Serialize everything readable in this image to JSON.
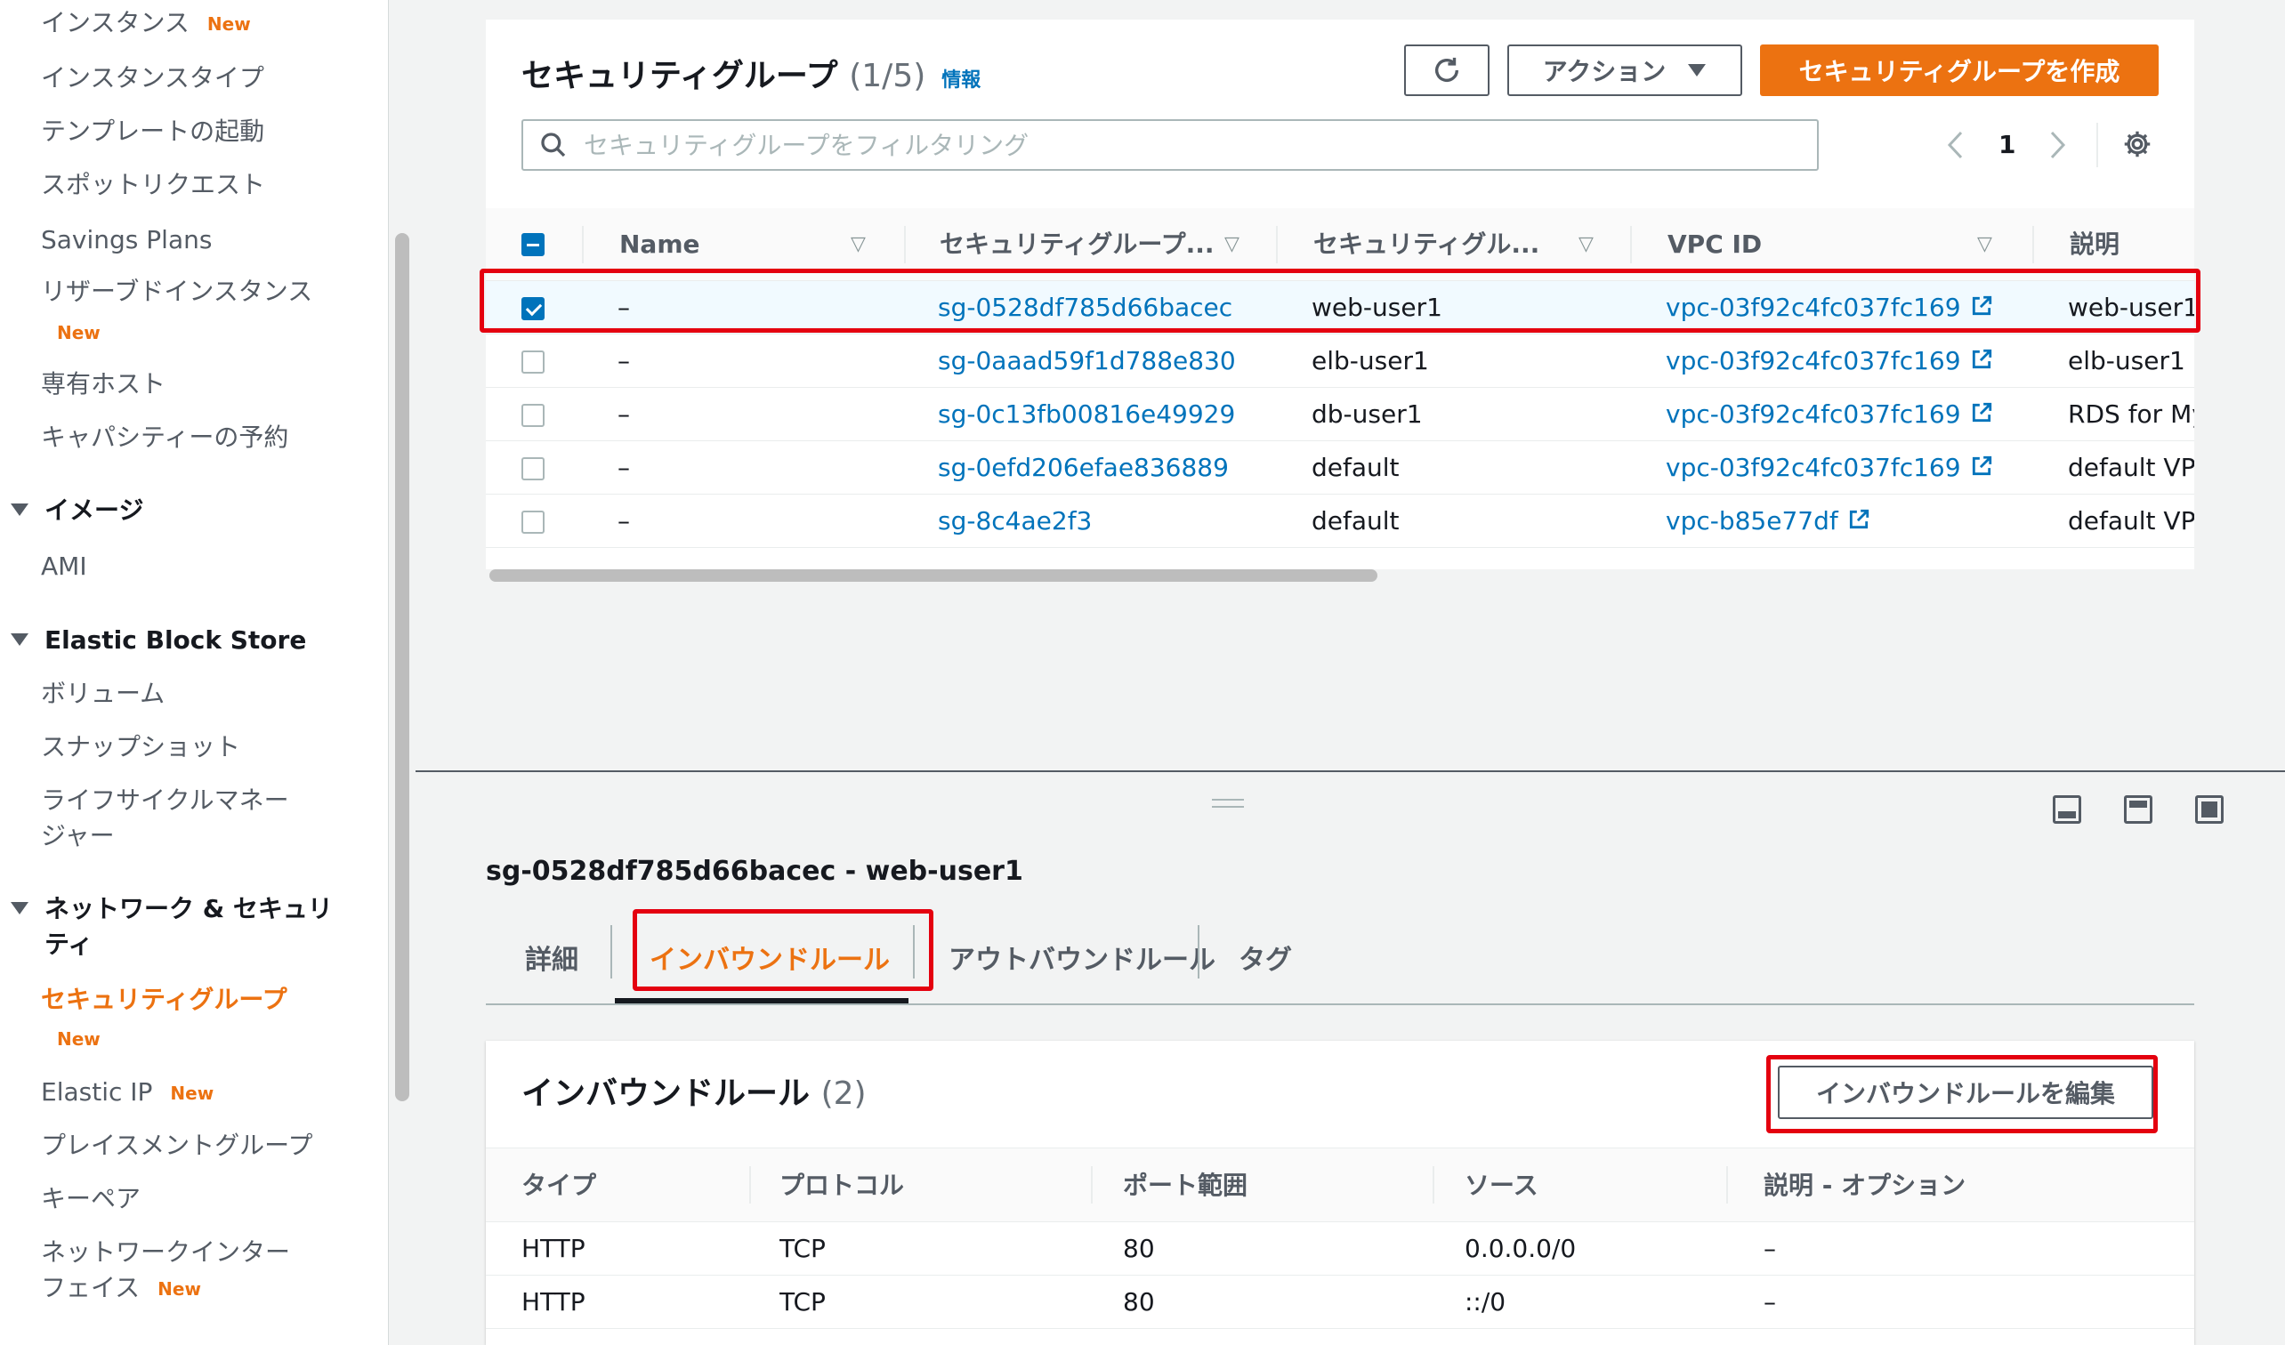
{
  "sidebar": {
    "items": [
      {
        "label": "インスタンス",
        "badge": "New"
      },
      {
        "label": "インスタンスタイプ"
      },
      {
        "label": "テンプレートの起動"
      },
      {
        "label": "スポットリクエスト"
      },
      {
        "label": "Savings Plans"
      },
      {
        "label": "リザーブドインスタンス",
        "badge": "New"
      },
      {
        "label": "専有ホスト"
      },
      {
        "label": "キャパシティーの予約"
      }
    ],
    "images_section": {
      "title": "イメージ",
      "items": [
        {
          "label": "AMI"
        }
      ]
    },
    "ebs_section": {
      "title": "Elastic Block Store",
      "items": [
        {
          "label": "ボリューム"
        },
        {
          "label": "スナップショット"
        },
        {
          "label": "ライフサイクルマネー",
          "label2": "ジャー"
        }
      ]
    },
    "network_section": {
      "title": "ネットワーク & セキュリ",
      "title2": "ティ",
      "items": [
        {
          "label": "セキュリティグループ",
          "badge": "New",
          "active": true
        },
        {
          "label": "Elastic IP",
          "badge": "New"
        },
        {
          "label": "プレイスメントグループ"
        },
        {
          "label": "キーペア"
        },
        {
          "label": "ネットワークインター",
          "label2": "フェイス",
          "badge": "New"
        }
      ]
    }
  },
  "sg_list": {
    "title": "セキュリティグループ",
    "count": "(1/5)",
    "info": "情報",
    "actions_label": "アクション",
    "create_label": "セキュリティグループを作成",
    "search_placeholder": "セキュリティグループをフィルタリング",
    "page": "1",
    "columns": [
      "Name",
      "セキュリティグループ...",
      "セキュリティグル...",
      "VPC ID",
      "説明"
    ],
    "rows": [
      {
        "name": "–",
        "sg_id": "sg-0528df785d66bacec",
        "sg_name": "web-user1",
        "vpc": "vpc-03f92c4fc037fc169",
        "desc": "web-user1",
        "selected": true
      },
      {
        "name": "–",
        "sg_id": "sg-0aaad59f1d788e830",
        "sg_name": "elb-user1",
        "vpc": "vpc-03f92c4fc037fc169",
        "desc": "elb-user1",
        "selected": false
      },
      {
        "name": "–",
        "sg_id": "sg-0c13fb00816e49929",
        "sg_name": "db-user1",
        "vpc": "vpc-03f92c4fc037fc169",
        "desc": "RDS for My",
        "selected": false
      },
      {
        "name": "–",
        "sg_id": "sg-0efd206efae836889",
        "sg_name": "default",
        "vpc": "vpc-03f92c4fc037fc169",
        "desc": "default VPC",
        "selected": false
      },
      {
        "name": "–",
        "sg_id": "sg-8c4ae2f3",
        "sg_name": "default",
        "vpc": "vpc-b85e77df",
        "desc": "default VPC",
        "selected": false
      }
    ]
  },
  "detail": {
    "title": "sg-0528df785d66bacec - web-user1",
    "tabs": [
      "詳細",
      "インバウンドルール",
      "アウトバウンドルール",
      "タグ"
    ],
    "active_tab": 1
  },
  "inbound": {
    "title": "インバウンドルール",
    "count": "(2)",
    "edit_label": "インバウンドルールを編集",
    "columns": [
      "タイプ",
      "プロトコル",
      "ポート範囲",
      "ソース",
      "説明 - オプション"
    ],
    "rows": [
      {
        "type": "HTTP",
        "protocol": "TCP",
        "port": "80",
        "source": "0.0.0.0/0",
        "desc": "–"
      },
      {
        "type": "HTTP",
        "protocol": "TCP",
        "port": "80",
        "source": "::/0",
        "desc": "–"
      }
    ]
  },
  "colors": {
    "accent": "#ec7211",
    "link": "#0073bb",
    "highlight": "#e4000f"
  }
}
